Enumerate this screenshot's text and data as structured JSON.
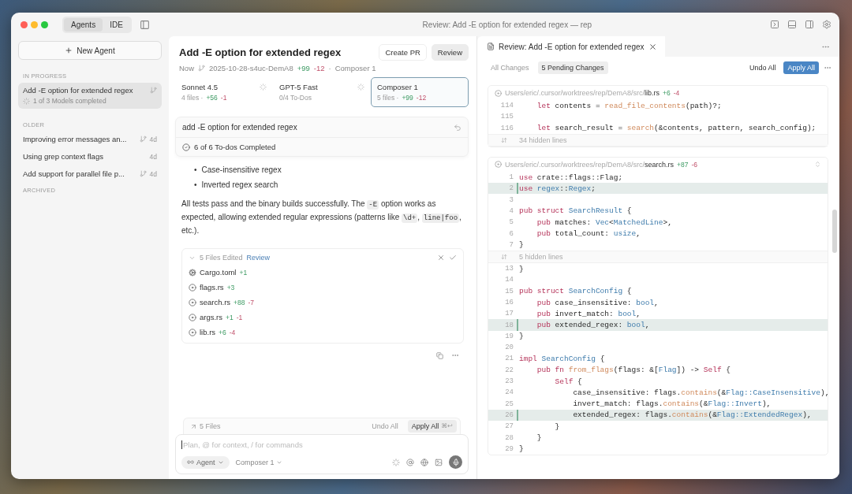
{
  "window": {
    "title": "Review: Add -E option for extended regex — rep",
    "mode_tabs": [
      {
        "label": "Agents",
        "selected": true
      },
      {
        "label": "IDE",
        "selected": false
      }
    ]
  },
  "sidebar": {
    "new_agent": "New Agent",
    "sections": [
      {
        "heading": "IN PROGRESS",
        "items": [
          {
            "title": "Add -E option for extended regex",
            "subtitle": "1 of 3 Models completed",
            "branch": true,
            "selected": true
          }
        ]
      },
      {
        "heading": "OLDER",
        "items": [
          {
            "title": "Improving error messages an...",
            "time": "4d",
            "branch": true,
            "selected": false
          },
          {
            "title": "Using grep context flags",
            "time": "4d",
            "branch": false,
            "selected": false
          },
          {
            "title": "Add support for parallel file p...",
            "time": "4d",
            "branch": true,
            "selected": false
          }
        ]
      },
      {
        "heading": "ARCHIVED"
      }
    ]
  },
  "agent": {
    "title": "Add -E option for extended regex",
    "buttons": [
      {
        "label": "Create PR",
        "kind": "outline"
      },
      {
        "label": "Review",
        "kind": "filled"
      }
    ],
    "meta": {
      "time": "Now",
      "branch": "2025-10-28-s4uc-DemA8",
      "added": "+99",
      "removed": "-12",
      "separator": "·",
      "model": "Composer 1"
    },
    "models": [
      {
        "name": "Sonnet 4.5",
        "detail": "4 files ·",
        "added": "+56",
        "removed": "-1",
        "running": true,
        "selected": false
      },
      {
        "name": "GPT-5 Fast",
        "detail": "0/4 To-Dos",
        "running": true,
        "selected": false
      },
      {
        "name": "Composer 1",
        "detail": "5 files ·",
        "added": "+99",
        "removed": "-12",
        "running": false,
        "selected": true
      }
    ],
    "prompt": "add -E option for extended regex",
    "todos": "6 of 6 To-dos Completed",
    "bullets": [
      {
        "marker": "•",
        "text": "Case-insensitive regex"
      },
      {
        "marker": "•",
        "text": "Inverted regex search"
      }
    ],
    "paragraph": [
      {
        "kind": "text",
        "t": "All tests pass and the binary builds successfully. The "
      },
      {
        "kind": "code",
        "t": "-E"
      },
      {
        "kind": "text",
        "t": " option works as expected, allowing extended regular expressions (patterns like "
      },
      {
        "kind": "code",
        "t": "\\d+"
      },
      {
        "kind": "text",
        "t": ", "
      },
      {
        "kind": "code",
        "t": "line|foo"
      },
      {
        "kind": "text",
        "t": ", etc.)."
      }
    ],
    "files_card": {
      "heading": "5 Files Edited",
      "review": "Review",
      "expanded": true,
      "files": [
        {
          "name": "Cargo.toml",
          "kind": "config",
          "added": "+1"
        },
        {
          "name": "flags.rs",
          "kind": "source",
          "added": "+3"
        },
        {
          "name": "search.rs",
          "kind": "source",
          "added": "+88",
          "removed": "-7"
        },
        {
          "name": "args.rs",
          "kind": "source",
          "added": "+1",
          "removed": "-1"
        },
        {
          "name": "lib.rs",
          "kind": "source",
          "added": "+6",
          "removed": "-4"
        }
      ]
    },
    "changes_bar": {
      "files": "5 Files",
      "undo": "Undo All",
      "apply": "Apply All",
      "shortcut": "⌘↩"
    },
    "composer": {
      "placeholder": "Plan, @ for context, / for commands",
      "mode": "Agent",
      "model": "Composer 1"
    }
  },
  "review": {
    "tab": "Review: Add -E option for extended regex",
    "filters": [
      {
        "label": "All Changes",
        "selected": false
      },
      {
        "label": "5 Pending Changes",
        "selected": true
      }
    ],
    "undo": "Undo All",
    "apply": "Apply All",
    "diffs": [
      {
        "dir": "Users/eric/.cursor/worktrees/rep/DemA8/src/",
        "file": "lib.rs",
        "added": "+6",
        "removed": "-4",
        "blocks": [
          {
            "kind": "code",
            "lines": [
              {
                "n": "114",
                "highlighted": false,
                "tokens": [
                  {
                    "kind": "keyword",
                    "t": "    let"
                  },
                  {
                    "kind": "plain",
                    "t": " contents = "
                  },
                  {
                    "kind": "function",
                    "t": "read_file_contents"
                  },
                  {
                    "kind": "plain",
                    "t": "(path)?;"
                  }
                ]
              },
              {
                "n": "115",
                "highlighted": false
              },
              {
                "n": "116",
                "highlighted": false,
                "tokens": [
                  {
                    "kind": "keyword",
                    "t": "    let"
                  },
                  {
                    "kind": "plain",
                    "t": " search_result = "
                  },
                  {
                    "kind": "function",
                    "t": "search"
                  },
                  {
                    "kind": "plain",
                    "t": "(&contents, pattern, search_config);"
                  }
                ]
              }
            ]
          },
          {
            "kind": "hidden",
            "label": "34 hidden lines"
          }
        ]
      },
      {
        "dir": "Users/eric/.cursor/worktrees/rep/DemA8/src/",
        "file": "search.rs",
        "added": "+87",
        "removed": "-6",
        "blocks": [
          {
            "kind": "code",
            "lines": [
              {
                "n": "1",
                "highlighted": false,
                "tokens": [
                  {
                    "kind": "keyword",
                    "t": "use"
                  },
                  {
                    "kind": "plain",
                    "t": " crate::flags::Flag;"
                  }
                ]
              },
              {
                "n": "2",
                "highlighted": true,
                "tokens": [
                  {
                    "kind": "keyword",
                    "t": "use"
                  },
                  {
                    "kind": "type",
                    "t": " regex"
                  },
                  {
                    "kind": "plain",
                    "t": "::"
                  },
                  {
                    "kind": "type",
                    "t": "Regex"
                  },
                  {
                    "kind": "plain",
                    "t": ";"
                  }
                ]
              },
              {
                "n": "3",
                "highlighted": false
              },
              {
                "n": "4",
                "highlighted": false,
                "tokens": [
                  {
                    "kind": "keyword",
                    "t": "pub struct"
                  },
                  {
                    "kind": "type",
                    "t": " SearchResult"
                  },
                  {
                    "kind": "plain",
                    "t": " {"
                  }
                ]
              },
              {
                "n": "5",
                "highlighted": false,
                "tokens": [
                  {
                    "kind": "keyword",
                    "t": "    pub"
                  },
                  {
                    "kind": "plain",
                    "t": " matches: "
                  },
                  {
                    "kind": "type",
                    "t": "Vec"
                  },
                  {
                    "kind": "plain",
                    "t": "<"
                  },
                  {
                    "kind": "type",
                    "t": "MatchedLine"
                  },
                  {
                    "kind": "plain",
                    "t": ">,"
                  }
                ]
              },
              {
                "n": "6",
                "highlighted": false,
                "tokens": [
                  {
                    "kind": "keyword",
                    "t": "    pub"
                  },
                  {
                    "kind": "plain",
                    "t": " total_count: "
                  },
                  {
                    "kind": "type",
                    "t": "usize"
                  },
                  {
                    "kind": "plain",
                    "t": ","
                  }
                ]
              },
              {
                "n": "7",
                "highlighted": false,
                "tokens": [
                  {
                    "kind": "plain",
                    "t": "}"
                  }
                ]
              }
            ]
          },
          {
            "kind": "hidden",
            "label": "5 hidden lines"
          },
          {
            "kind": "code",
            "lines": [
              {
                "n": "13",
                "highlighted": false,
                "tokens": [
                  {
                    "kind": "plain",
                    "t": "}"
                  }
                ]
              },
              {
                "n": "14",
                "highlighted": false
              },
              {
                "n": "15",
                "highlighted": false,
                "tokens": [
                  {
                    "kind": "keyword",
                    "t": "pub struct"
                  },
                  {
                    "kind": "type",
                    "t": " SearchConfig"
                  },
                  {
                    "kind": "plain",
                    "t": " {"
                  }
                ]
              },
              {
                "n": "16",
                "highlighted": false,
                "tokens": [
                  {
                    "kind": "keyword",
                    "t": "    pub"
                  },
                  {
                    "kind": "plain",
                    "t": " case_insensitive: "
                  },
                  {
                    "kind": "type",
                    "t": "bool"
                  },
                  {
                    "kind": "plain",
                    "t": ","
                  }
                ]
              },
              {
                "n": "17",
                "highlighted": false,
                "tokens": [
                  {
                    "kind": "keyword",
                    "t": "    pub"
                  },
                  {
                    "kind": "plain",
                    "t": " invert_match: "
                  },
                  {
                    "kind": "type",
                    "t": "bool"
                  },
                  {
                    "kind": "plain",
                    "t": ","
                  }
                ]
              },
              {
                "n": "18",
                "highlighted": true,
                "tokens": [
                  {
                    "kind": "keyword",
                    "t": "    pub"
                  },
                  {
                    "kind": "plain",
                    "t": " extended_regex: "
                  },
                  {
                    "kind": "type",
                    "t": "bool"
                  },
                  {
                    "kind": "plain",
                    "t": ","
                  }
                ]
              },
              {
                "n": "19",
                "highlighted": false,
                "tokens": [
                  {
                    "kind": "plain",
                    "t": "}"
                  }
                ]
              },
              {
                "n": "20",
                "highlighted": false
              },
              {
                "n": "21",
                "highlighted": false,
                "tokens": [
                  {
                    "kind": "keyword",
                    "t": "impl"
                  },
                  {
                    "kind": "type",
                    "t": " SearchConfig"
                  },
                  {
                    "kind": "plain",
                    "t": " {"
                  }
                ]
              },
              {
                "n": "22",
                "highlighted": false,
                "tokens": [
                  {
                    "kind": "keyword",
                    "t": "    pub fn"
                  },
                  {
                    "kind": "function",
                    "t": " from_flags"
                  },
                  {
                    "kind": "plain",
                    "t": "(flags: &["
                  },
                  {
                    "kind": "type",
                    "t": "Flag"
                  },
                  {
                    "kind": "plain",
                    "t": "]) ->"
                  },
                  {
                    "kind": "keyword",
                    "t": " Self"
                  },
                  {
                    "kind": "plain",
                    "t": " {"
                  }
                ]
              },
              {
                "n": "23",
                "highlighted": false,
                "tokens": [
                  {
                    "kind": "keyword",
                    "t": "        Self"
                  },
                  {
                    "kind": "plain",
                    "t": " {"
                  }
                ]
              },
              {
                "n": "24",
                "highlighted": false,
                "tokens": [
                  {
                    "kind": "plain",
                    "t": "            case_insensitive: flags."
                  },
                  {
                    "kind": "function",
                    "t": "contains"
                  },
                  {
                    "kind": "plain",
                    "t": "(&"
                  },
                  {
                    "kind": "type",
                    "t": "Flag::CaseInsensitive"
                  },
                  {
                    "kind": "plain",
                    "t": "),"
                  }
                ]
              },
              {
                "n": "25",
                "highlighted": false,
                "tokens": [
                  {
                    "kind": "plain",
                    "t": "            invert_match: flags."
                  },
                  {
                    "kind": "function",
                    "t": "contains"
                  },
                  {
                    "kind": "plain",
                    "t": "(&"
                  },
                  {
                    "kind": "type",
                    "t": "Flag::Invert"
                  },
                  {
                    "kind": "plain",
                    "t": "),"
                  }
                ]
              },
              {
                "n": "26",
                "highlighted": true,
                "tokens": [
                  {
                    "kind": "plain",
                    "t": "            extended_regex: flags."
                  },
                  {
                    "kind": "function",
                    "t": "contains"
                  },
                  {
                    "kind": "plain",
                    "t": "(&"
                  },
                  {
                    "kind": "type",
                    "t": "Flag::ExtendedRegex"
                  },
                  {
                    "kind": "plain",
                    "t": "),"
                  }
                ]
              },
              {
                "n": "27",
                "highlighted": false,
                "tokens": [
                  {
                    "kind": "plain",
                    "t": "        }"
                  }
                ]
              },
              {
                "n": "28",
                "highlighted": false,
                "tokens": [
                  {
                    "kind": "plain",
                    "t": "    }"
                  }
                ]
              },
              {
                "n": "29",
                "highlighted": false,
                "tokens": [
                  {
                    "kind": "plain",
                    "t": "}"
                  }
                ]
              }
            ]
          }
        ]
      }
    ]
  }
}
